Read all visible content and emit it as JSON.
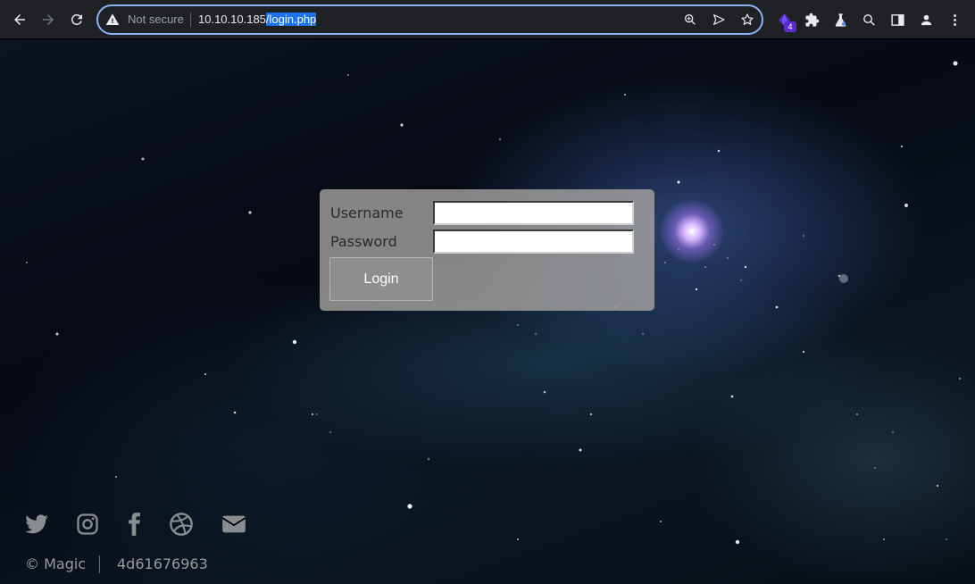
{
  "browser": {
    "security_label": "Not secure",
    "url_host": "10.10.10.185",
    "url_path": "/login.php",
    "extension_badge": "4",
    "accent_color": "#8ab4f8"
  },
  "login": {
    "username_label": "Username",
    "password_label": "Password",
    "username_value": "",
    "password_value": "",
    "login_button_label": "Login"
  },
  "footer": {
    "social_icons": [
      "twitter-icon",
      "instagram-icon",
      "facebook-icon",
      "dribbble-icon",
      "envelope-icon"
    ],
    "copyright": "© Magic",
    "code": "4d61676963"
  }
}
